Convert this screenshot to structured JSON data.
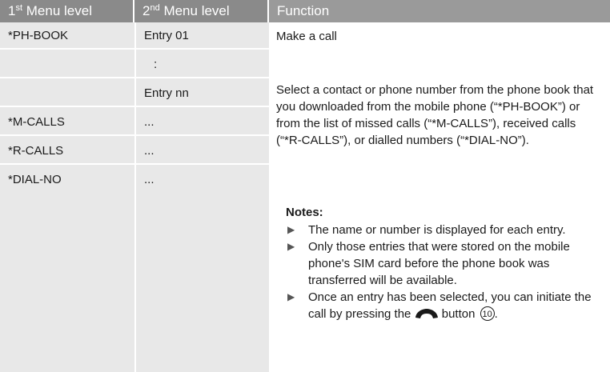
{
  "header": {
    "col1_num": "1",
    "col1_sup": "st",
    "col1_rest": " Menu level",
    "col2_num": "2",
    "col2_sup": "nd",
    "col2_rest": " Menu level",
    "col3": "Function"
  },
  "rows": [
    {
      "level1": "*PH-BOOK",
      "level2": "Entry 01"
    },
    {
      "level1": "",
      "level2": ":"
    },
    {
      "level1": "",
      "level2": "Entry nn"
    },
    {
      "level1": "*M-CALLS",
      "level2": "..."
    },
    {
      "level1": "*R-CALLS",
      "level2": "..."
    },
    {
      "level1": "*DIAL-NO",
      "level2": "..."
    }
  ],
  "function": {
    "call": "Make a call",
    "select": "Select a contact or phone number from the phone book that you downloaded from the mobile phone (“*PH-BOOK”) or from the list of missed calls (“*M-CALLS”), received calls (“*R-CALLS”), or dialled numbers (“*DIAL-NO”).",
    "notes_title": "Notes:",
    "notes": [
      "The name or number is displayed for each entry.",
      "Only those entries that were stored on the mobile phone's SIM card before the phone book was transferred will be available.",
      "Once an entry has been selected, you can initiate the call by pressing the"
    ],
    "note3_suffix": "button",
    "button_number": "10"
  },
  "icons": {
    "bullet": "triangle-right-icon",
    "phone": "phone-handset-icon"
  },
  "colors": {
    "header_bg": "#8a8a8a",
    "cell_bg": "#e8e8e8"
  }
}
